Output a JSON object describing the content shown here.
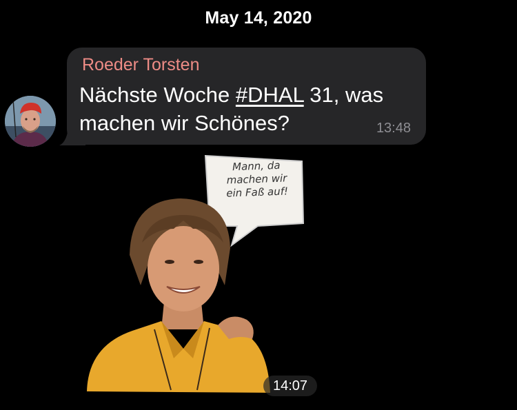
{
  "date_header": "May 14, 2020",
  "message": {
    "sender": "Roeder Torsten",
    "text_before": "Nächste Woche ",
    "hashtag": "#DHAL",
    "text_after": " 31, was machen wir Schönes?",
    "time": "13:48"
  },
  "sticker": {
    "speech_line1": "Mann, da",
    "speech_line2": "machen wir",
    "speech_line3": "ein Faß auf!",
    "time": "14:07"
  },
  "colors": {
    "background": "#000000",
    "bubble": "#262628",
    "sender_name": "#ee8c86",
    "timestamp": "#8e8e93"
  }
}
